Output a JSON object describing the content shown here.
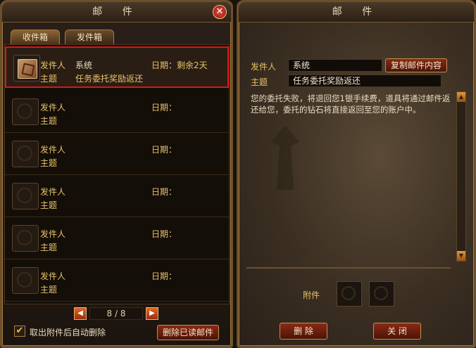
{
  "left": {
    "title": "邮 件",
    "tabs": [
      {
        "label": "收件箱"
      },
      {
        "label": "发件箱"
      }
    ],
    "mails": [
      {
        "sender_label": "发件人",
        "sender": "系统",
        "subject_label": "主题",
        "subject": "任务委托奖励返还",
        "date_label": "日期：",
        "date": "剩余2天"
      },
      {
        "sender_label": "发件人",
        "sender": "",
        "subject_label": "主题",
        "subject": "",
        "date_label": "日期：",
        "date": ""
      },
      {
        "sender_label": "发件人",
        "sender": "",
        "subject_label": "主题",
        "subject": "",
        "date_label": "日期：",
        "date": ""
      },
      {
        "sender_label": "发件人",
        "sender": "",
        "subject_label": "主题",
        "subject": "",
        "date_label": "日期：",
        "date": ""
      },
      {
        "sender_label": "发件人",
        "sender": "",
        "subject_label": "主题",
        "subject": "",
        "date_label": "日期：",
        "date": ""
      },
      {
        "sender_label": "发件人",
        "sender": "",
        "subject_label": "主题",
        "subject": "",
        "date_label": "日期：",
        "date": ""
      }
    ],
    "pager": {
      "text": "8 / 8",
      "prev": "◀",
      "next": "▶"
    },
    "auto_delete": {
      "label": "取出附件后自动删除",
      "checked": true,
      "mark": "✔"
    },
    "delete_read_label": "删除已读邮件"
  },
  "right": {
    "title": "邮 件",
    "sender_label": "发件人",
    "sender_value": "系统",
    "copy_label": "复制邮件内容",
    "subject_label": "主题",
    "subject_value": "任务委托奖励返还",
    "body": "您的委托失败，将退回您1银手续费，道具将通过邮件返还给您，委托的钻石将直接返回至您的账户中。",
    "attachment_label": "附件",
    "delete_label": "删 除",
    "close_label": "关 闭"
  },
  "colors": {
    "accent_gold": "#e8c36a",
    "selection_red": "#d81818",
    "button_red": "#8a2a14"
  }
}
